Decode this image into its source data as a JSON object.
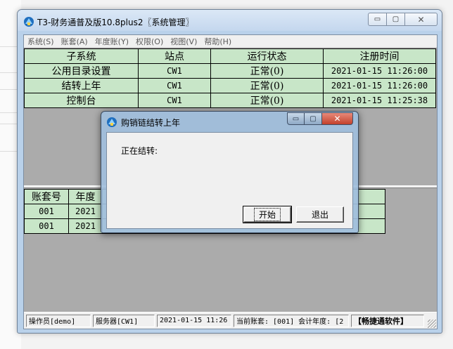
{
  "window": {
    "title": "T3-财务通普及版10.8plus2〖系统管理〗",
    "icon": "t3-app-icon",
    "controls": {
      "minimize": "▭",
      "maximize": "▢",
      "close": "✕"
    }
  },
  "menu": [
    "系统(S)",
    "账套(A)",
    "年度账(Y)",
    "权限(O)",
    "视图(V)",
    "帮助(H)"
  ],
  "system_table": {
    "headers": [
      "子系统",
      "站点",
      "运行状态",
      "注册时间"
    ],
    "rows": [
      [
        "公用目录设置",
        "CW1",
        "正常(0)",
        "2021-01-15 11:26:00"
      ],
      [
        "结转上年",
        "CW1",
        "正常(0)",
        "2021-01-15 11:26:00"
      ],
      [
        "控制台",
        "CW1",
        "正常(0)",
        "2021-01-15 11:25:38"
      ]
    ]
  },
  "account_table": {
    "headers": [
      "账套号",
      "年度"
    ],
    "rows": [
      [
        "001",
        "2021"
      ],
      [
        "001",
        "2021"
      ]
    ]
  },
  "status_bar": [
    "操作员[demo]",
    "服务器[CW1]",
    "2021-01-15 11:26",
    "当前账套: [001] 会计年度: [2",
    "【畅捷通软件】"
  ],
  "dialog": {
    "title": "购销链结转上年",
    "message": "正在结转:",
    "start_button": "开始",
    "exit_button": "退出",
    "controls": {
      "minimize": "▭",
      "maximize": "▢",
      "close": "✕"
    }
  },
  "colors": {
    "grid_green": "#c8e6c8",
    "client_gray": "#ababab",
    "frame_blue": "#b9d1ea"
  }
}
